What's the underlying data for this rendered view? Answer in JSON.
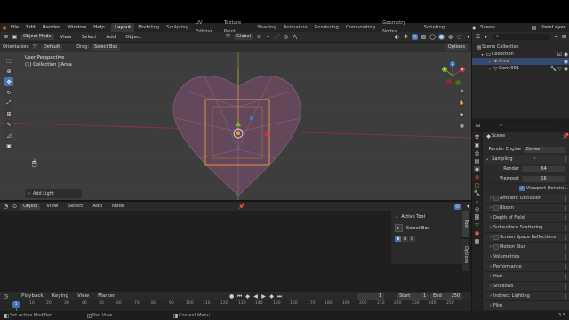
{
  "menu": {
    "items": [
      "File",
      "Edit",
      "Render",
      "Window",
      "Help"
    ],
    "workspaces": [
      "Layout",
      "Modeling",
      "Sculpting",
      "UV Editing",
      "Texture Paint",
      "Shading",
      "Animation",
      "Rendering",
      "Compositing",
      "Geometry Nodes",
      "Scripting"
    ],
    "active_workspace": "Layout",
    "scene": "Scene",
    "view_layer": "ViewLayer"
  },
  "viewport_header": {
    "mode": "Object Mode",
    "menus": [
      "View",
      "Select",
      "Add",
      "Object"
    ],
    "transform": "Global",
    "options": "Options"
  },
  "tool_settings": {
    "orientation_label": "Orientation:",
    "orientation_value": "Default",
    "drag_label": "Drag:",
    "drag_value": "Select Box"
  },
  "viewport": {
    "perspective": "User Perspective",
    "collection": "(1) Collection | Area",
    "last_op": "Add Light",
    "gizmo": {
      "x": "X",
      "y": "Y",
      "z": "Z"
    }
  },
  "outliner": {
    "root": "Scene Collection",
    "items": [
      {
        "label": "Collection",
        "indent": 1
      },
      {
        "label": "Area",
        "indent": 2,
        "selected": true
      },
      {
        "label": "Gem.001",
        "indent": 2,
        "selected": false
      }
    ]
  },
  "properties": {
    "scene": "Scene",
    "render_engine_label": "Render Engine",
    "render_engine": "Eevee",
    "sampling": "Sampling",
    "render_label": "Render",
    "render_value": "64",
    "viewport_label": "Viewport",
    "viewport_value": "16",
    "denoise_label": "Viewport Denoisi...",
    "panels": [
      "Ambient Occlusion",
      "Bloom",
      "Depth of Field",
      "Subsurface Scattering",
      "Screen Space Reflections",
      "Motion Blur",
      "Volumetrics",
      "Performance",
      "Hair",
      "Shadows",
      "Indirect Lighting",
      "Film"
    ]
  },
  "node_editor": {
    "type": "Object",
    "menus": [
      "View",
      "Select",
      "Add",
      "Node"
    ],
    "active_tool_title": "Active Tool",
    "active_tool": "Select Box",
    "tabs": [
      "Tool",
      "Options"
    ]
  },
  "timeline": {
    "menus": [
      "Playback",
      "Keying",
      "View",
      "Marker"
    ],
    "current_frame": "1",
    "start_label": "Start",
    "start": "1",
    "end_label": "End",
    "end": "250",
    "ticks": [
      "1",
      "10",
      "20",
      "30",
      "40",
      "50",
      "60",
      "70",
      "80",
      "90",
      "100",
      "110",
      "120",
      "130",
      "140",
      "150",
      "160",
      "170",
      "180",
      "190",
      "200",
      "210",
      "220",
      "230",
      "240",
      "250"
    ],
    "frame_badge": "1"
  },
  "statusbar": {
    "items": [
      "Set Active Modifier",
      "Pan View",
      "Context Menu"
    ],
    "version": "3.5"
  },
  "colors": {
    "accent": "#4772b3",
    "selection_orange": "#f29d3d",
    "axis_red": "#c8343e",
    "axis_green": "#7bb62a",
    "axis_blue": "#3a78d6",
    "gem_fill": "#6a4a62"
  }
}
